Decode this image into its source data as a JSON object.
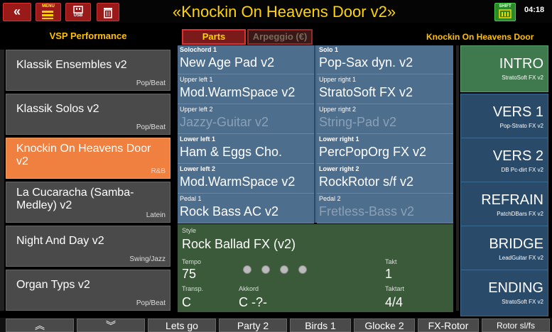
{
  "topbar": {
    "back_label": "«",
    "menu_badge": "MENU",
    "usb_badge": "USB",
    "shift_badge": "SHIFT",
    "title": "«Knockin On Heavens Door v2»",
    "time": "04:18",
    "icons": [
      "back-icon",
      "menu-icon",
      "usb-icon",
      "trash-icon",
      "shift-icon"
    ]
  },
  "header": {
    "left_title": "VSP Performance",
    "tab_parts": "Parts",
    "tab_arpeggio": "Arpeggio (€)",
    "right_title": "Knockin On Heavens Door"
  },
  "songs": [
    {
      "name": "Klassik Ensembles v2",
      "category": "Pop/Beat"
    },
    {
      "name": "Klassik Solos v2",
      "category": "Pop/Beat"
    },
    {
      "name": "Knockin On Heavens Door v2",
      "category": "R&B",
      "active": true
    },
    {
      "name": "La Cucaracha (Samba-Medley) v2",
      "category": "Latein"
    },
    {
      "name": "Night And Day v2",
      "category": "Swing/Jazz"
    },
    {
      "name": "Organ Typs v2",
      "category": "Pop/Beat"
    }
  ],
  "parts": {
    "solochord1": {
      "label": "Solochord 1",
      "value": "New Age Pad v2"
    },
    "solo1": {
      "label": "Solo 1",
      "value": "Pop-Sax dyn. v2"
    },
    "upper_left1": {
      "label": "Upper left 1",
      "value": "Mod.WarmSpace v2"
    },
    "upper_right1": {
      "label": "Upper right 1",
      "value": "StratoSoft FX v2"
    },
    "upper_left2": {
      "label": "Upper left 2",
      "value": "Jazzy-Guitar v2"
    },
    "upper_right2": {
      "label": "Upper right 2",
      "value": "String-Pad v2"
    },
    "lower_left1": {
      "label": "Lower left 1",
      "value": "Ham & Eggs Cho."
    },
    "lower_right1": {
      "label": "Lower right 1",
      "value": "PercPopOrg FX v2"
    },
    "lower_left2": {
      "label": "Lower left 2",
      "value": "Mod.WarmSpace v2"
    },
    "lower_right2": {
      "label": "Lower right 2",
      "value": "RockRotor s/f v2"
    },
    "pedal1": {
      "label": "Pedal 1",
      "value": "Rock Bass AC v2"
    },
    "pedal2": {
      "label": "Pedal 2",
      "value": "Fretless-Bass v2"
    }
  },
  "style": {
    "style_label": "Style",
    "style_value": "Rock Ballad FX (v2)",
    "tempo_label": "Tempo",
    "tempo_value": "75",
    "takt_label": "Takt",
    "takt_value": "1",
    "transp_label": "Transp.",
    "transp_value": "C",
    "akkord_label": "Akkord",
    "akkord_value": "C -?-",
    "taktart_label": "Taktart",
    "taktart_value": "4/4",
    "beats": 4
  },
  "sections": [
    {
      "name": "INTRO",
      "sound": "StratoSoft FX v2",
      "active": true
    },
    {
      "name": "VERS 1",
      "sound": "Pop-Strato FX v2"
    },
    {
      "name": "VERS 2",
      "sound": "DB Pc-dirt FX v2"
    },
    {
      "name": "REFRAIN",
      "sound": "PatchDBars FX v2"
    },
    {
      "name": "BRIDGE",
      "sound": "LeadGuitar FX v2"
    },
    {
      "name": "ENDING",
      "sound": "StratoSoft FX v2"
    }
  ],
  "bottom": {
    "up_label": "≈",
    "down_label": "≈",
    "buttons": [
      "Lets go",
      "Party 2",
      "Birds 1",
      "Glocke 2",
      "FX-Rotor",
      "Rotor sl/fs"
    ]
  },
  "colors": {
    "title": "#ffd400",
    "accent_orange": "#f08040",
    "parts_bg": "#4e6e8e",
    "style_bg": "#3a5a3a",
    "section_active": "#3e7a4e"
  }
}
